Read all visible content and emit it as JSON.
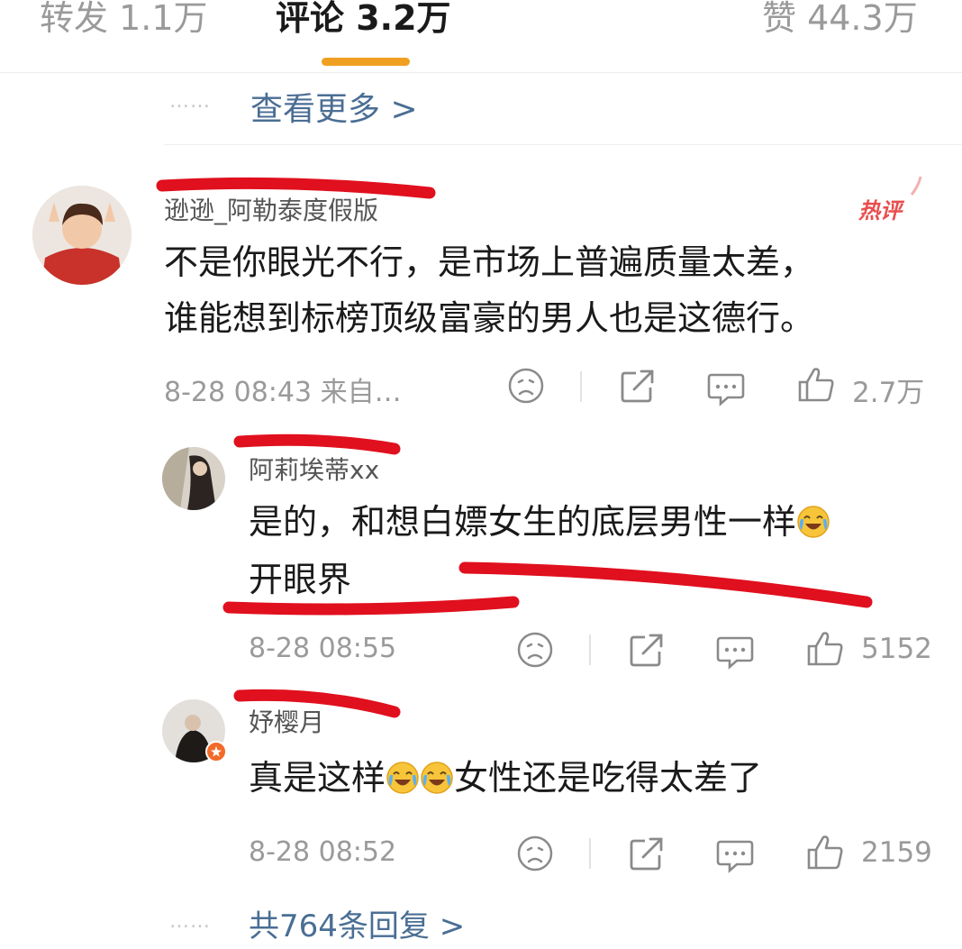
{
  "tabs": [
    {
      "label": "转发 1.1万",
      "active": false
    },
    {
      "label": "评论 3.2万",
      "active": true
    },
    {
      "label": "赞 44.3万",
      "active": false
    }
  ],
  "top_more": {
    "dots": "……",
    "label": "查看更多 >"
  },
  "main_comment": {
    "username": "逊逊_阿勒泰度假版",
    "hot_badge": "热评",
    "lines": [
      "不是你眼光不行，是市场上普遍质量太差，",
      "谁能想到标榜顶级富豪的男人也是这德行。"
    ],
    "meta": "8-28 08:43 来自…",
    "likes": "2.7万"
  },
  "replies": [
    {
      "username": "阿莉埃蒂xx",
      "line1": "是的，和想白嫖女生的底层男性一样",
      "line2": "开眼界",
      "time": "8-28 08:55",
      "likes": "5152"
    },
    {
      "username": "妤樱月",
      "text_a": "真是这样",
      "text_b": "女性还是吃得太差了",
      "time": "8-28 08:52",
      "likes": "2159"
    }
  ],
  "replies_more": {
    "dots": "……",
    "label": "共764条回复 >"
  },
  "colors": {
    "accent": "#f0a020",
    "link": "#4a6e94",
    "annotation": "#e0101e",
    "hot": "#e94e4e"
  }
}
